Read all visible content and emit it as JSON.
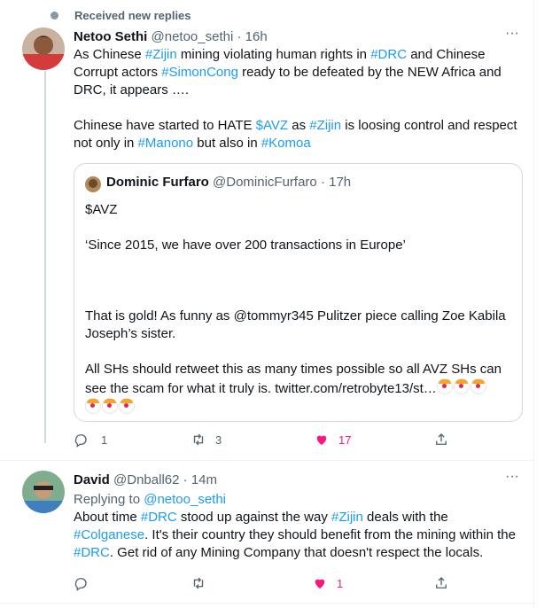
{
  "notice": {
    "label": "Received new replies"
  },
  "tweet1": {
    "name": "Netoo Sethi",
    "handle": "@netoo_sethi",
    "sep": "·",
    "time": "16h",
    "p1": [
      "As Chinese ",
      "#Zijin",
      " mining violating human rights in ",
      "#DRC",
      " and Chinese Corrupt actors ",
      "#SimonCong",
      "  ready to be defeated by the NEW Africa and DRC, it appears …."
    ],
    "p2": [
      "Chinese have started to HATE  ",
      "$AVZ",
      " as ",
      "#Zijin",
      " is loosing control and respect not only in ",
      "#Manono",
      " but also in ",
      "#Komoa"
    ],
    "quote": {
      "name": "Dominic Furfaro",
      "handle": "@DominicFurfaro",
      "sep": "·",
      "time": "17h",
      "l1": "$AVZ",
      "l2": "‘Since 2015, we have over 200 transactions in Europe’",
      "l3": "That is gold! As funny as @tommyr345  Pulitzer piece calling Zoe Kabila Joseph’s sister.",
      "l4": "All SHs should retweet this as many times possible so all AVZ SHs can see the scam for what it truly is. twitter.com/retrobyte13/st…"
    },
    "actions": {
      "replies": "1",
      "retweets": "3",
      "likes": "17"
    }
  },
  "tweet2": {
    "name": "David",
    "handle": "@Dnball62",
    "sep": "·",
    "time": "14m",
    "replying_prefix": "Replying to ",
    "replying_to": "@netoo_sethi",
    "p": [
      "About time ",
      "#DRC",
      " stood up against the way ",
      "#Zijin",
      " deals with the ",
      "#Colganese",
      ". It's their country they should benefit from the mining within the ",
      "#DRC",
      ". Get rid of any Mining Company that doesn't respect the locals."
    ],
    "actions": {
      "likes": "1"
    }
  },
  "icons": [
    "more-icon",
    "reply-icon",
    "retweet-icon",
    "like-icon",
    "share-icon"
  ],
  "colors": {
    "link": "#1d9bf0",
    "like": "#f91880",
    "muted": "#536471"
  }
}
